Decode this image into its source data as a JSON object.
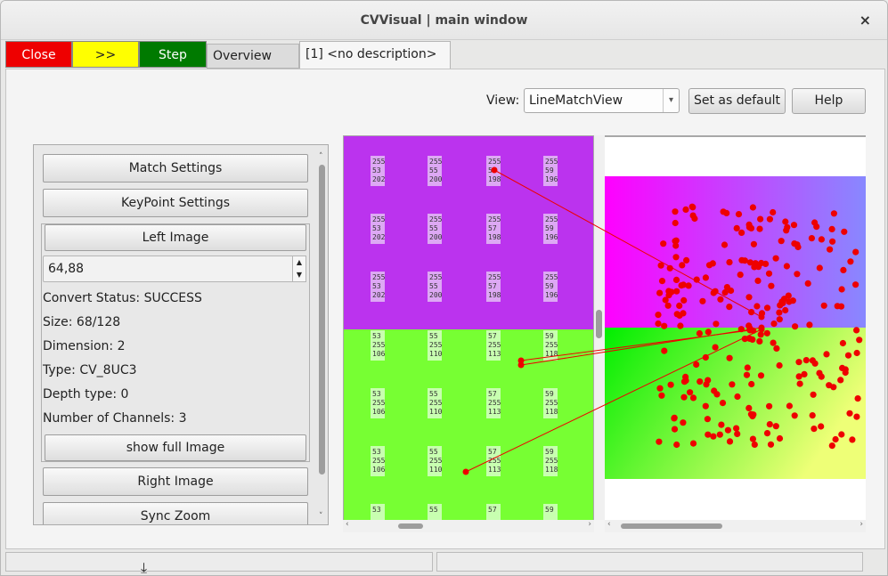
{
  "window": {
    "title": "CVVisual | main window",
    "close_glyph": "×"
  },
  "toolbar": {
    "close_label": "Close",
    "next_label": ">>",
    "step_label": "Step"
  },
  "tabs": [
    {
      "label": "Overview"
    },
    {
      "label": "[1] <no description>",
      "close_glyph": "×"
    }
  ],
  "view": {
    "label": "View:",
    "selected": "LineMatchView",
    "set_default_label": "Set as default",
    "help_label": "Help"
  },
  "panel": {
    "match_settings": "Match Settings",
    "keypoint_settings": "KeyPoint Settings",
    "left_image": "Left Image",
    "zoom_value": "64,88",
    "info": [
      "Convert Status: SUCCESS",
      "Size: 68/128",
      "Dimension: 2",
      "Type: CV_8UC3",
      "Depth type: 0",
      "Number of Channels: 3"
    ],
    "show_full_image": "show full Image",
    "right_image": "Right Image",
    "sync_zoom": "Sync Zoom"
  },
  "left_image": {
    "colors": {
      "top": "#bb33ee",
      "bottom": "#77ff33"
    },
    "top_rows": [
      [
        [
          "255",
          "53",
          "202"
        ],
        [
          "255",
          "55",
          "200"
        ],
        [
          "255",
          "57",
          "198"
        ],
        [
          "255",
          "59",
          "196"
        ]
      ],
      [
        [
          "255",
          "53",
          "202"
        ],
        [
          "255",
          "55",
          "200"
        ],
        [
          "255",
          "57",
          "198"
        ],
        [
          "255",
          "59",
          "196"
        ]
      ],
      [
        [
          "255",
          "53",
          "202"
        ],
        [
          "255",
          "55",
          "200"
        ],
        [
          "255",
          "57",
          "198"
        ],
        [
          "255",
          "59",
          "196"
        ]
      ]
    ],
    "bottom_rows": [
      [
        [
          "53",
          "255",
          "106"
        ],
        [
          "55",
          "255",
          "110"
        ],
        [
          "57",
          "255",
          "113"
        ],
        [
          "59",
          "255",
          "118"
        ]
      ],
      [
        [
          "53",
          "255",
          "106"
        ],
        [
          "55",
          "255",
          "110"
        ],
        [
          "57",
          "255",
          "113"
        ],
        [
          "59",
          "255",
          "118"
        ]
      ],
      [
        [
          "53",
          "255",
          "106"
        ],
        [
          "55",
          "255",
          "110"
        ],
        [
          "57",
          "255",
          "113"
        ],
        [
          "59",
          "255",
          "118"
        ]
      ],
      [
        [
          "53",
          "",
          ""
        ],
        [
          "55",
          "",
          ""
        ],
        [
          "57",
          "",
          ""
        ],
        [
          "59",
          "",
          ""
        ]
      ]
    ]
  },
  "right_image": {
    "colors": {
      "magenta": "#ff00ff",
      "violet": "#8888ff",
      "green": "#00ee00",
      "yellow": "#eeff77"
    },
    "keypoint_color": "#ee0000"
  }
}
